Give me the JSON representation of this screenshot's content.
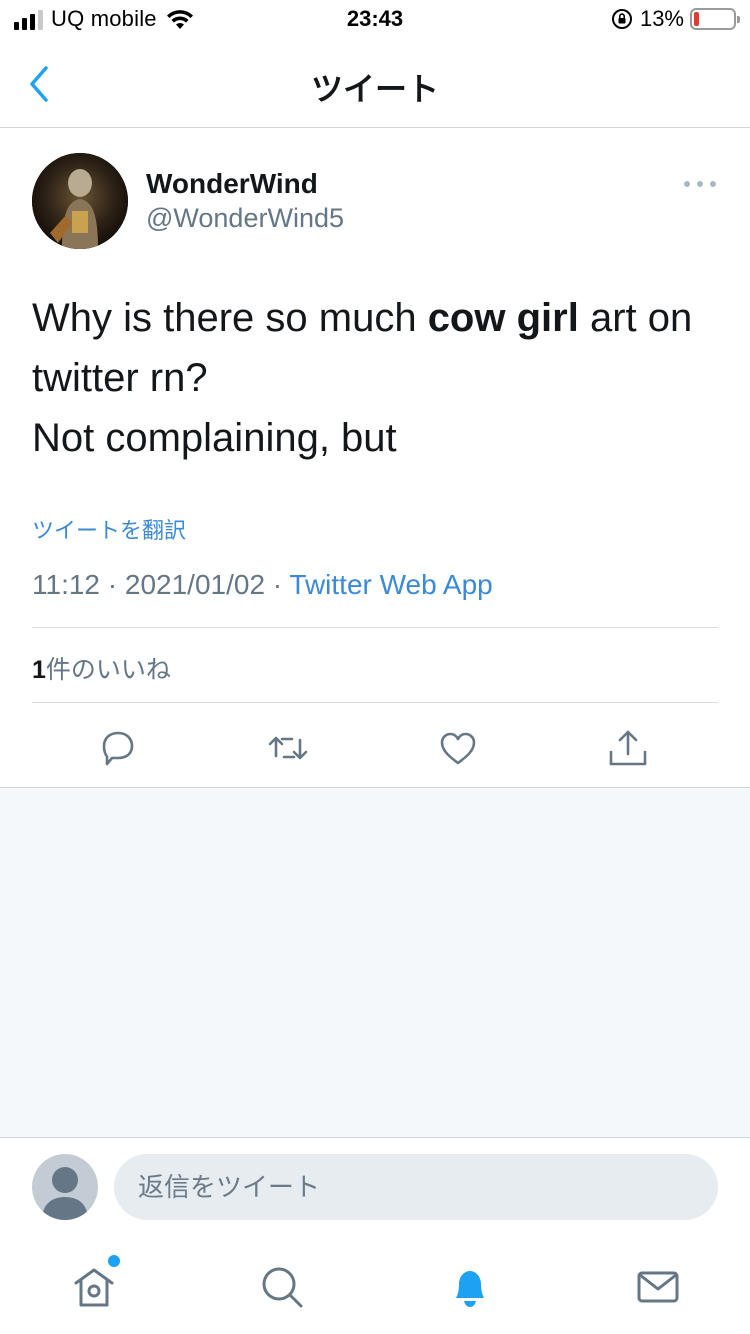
{
  "status_bar": {
    "carrier": "UQ mobile",
    "time": "23:43",
    "battery_percent": "13%",
    "battery_level": 0.13,
    "battery_color": "#e5382e"
  },
  "nav": {
    "title": "ツイート",
    "back_icon": "chevron-left-icon"
  },
  "tweet": {
    "author_name": "WonderWind",
    "author_handle": "@WonderWind5",
    "text_part1": "Why is there so much ",
    "text_bold": "cow girl",
    "text_part2": " art on twitter rn?",
    "text_line2": "Not complaining, but",
    "translate_label": "ツイートを翻訳",
    "timestamp": "11:12 · 2021/01/02 · ",
    "source": "Twitter Web App",
    "likes_count": "1",
    "likes_label": "件のいいね"
  },
  "actions": [
    {
      "icon": "reply-icon"
    },
    {
      "icon": "retweet-icon"
    },
    {
      "icon": "like-icon"
    },
    {
      "icon": "share-icon"
    }
  ],
  "reply_bar": {
    "placeholder": "返信をツイート"
  },
  "tab_bar": {
    "items": [
      {
        "icon": "home-icon",
        "has_notification_dot": true
      },
      {
        "icon": "search-icon"
      },
      {
        "icon": "bell-icon",
        "active": true
      },
      {
        "icon": "mail-icon"
      }
    ]
  },
  "colors": {
    "accent": "#1da1f2",
    "link": "#3a8ad8",
    "icon_gray": "#657786",
    "text": "#14171a"
  }
}
